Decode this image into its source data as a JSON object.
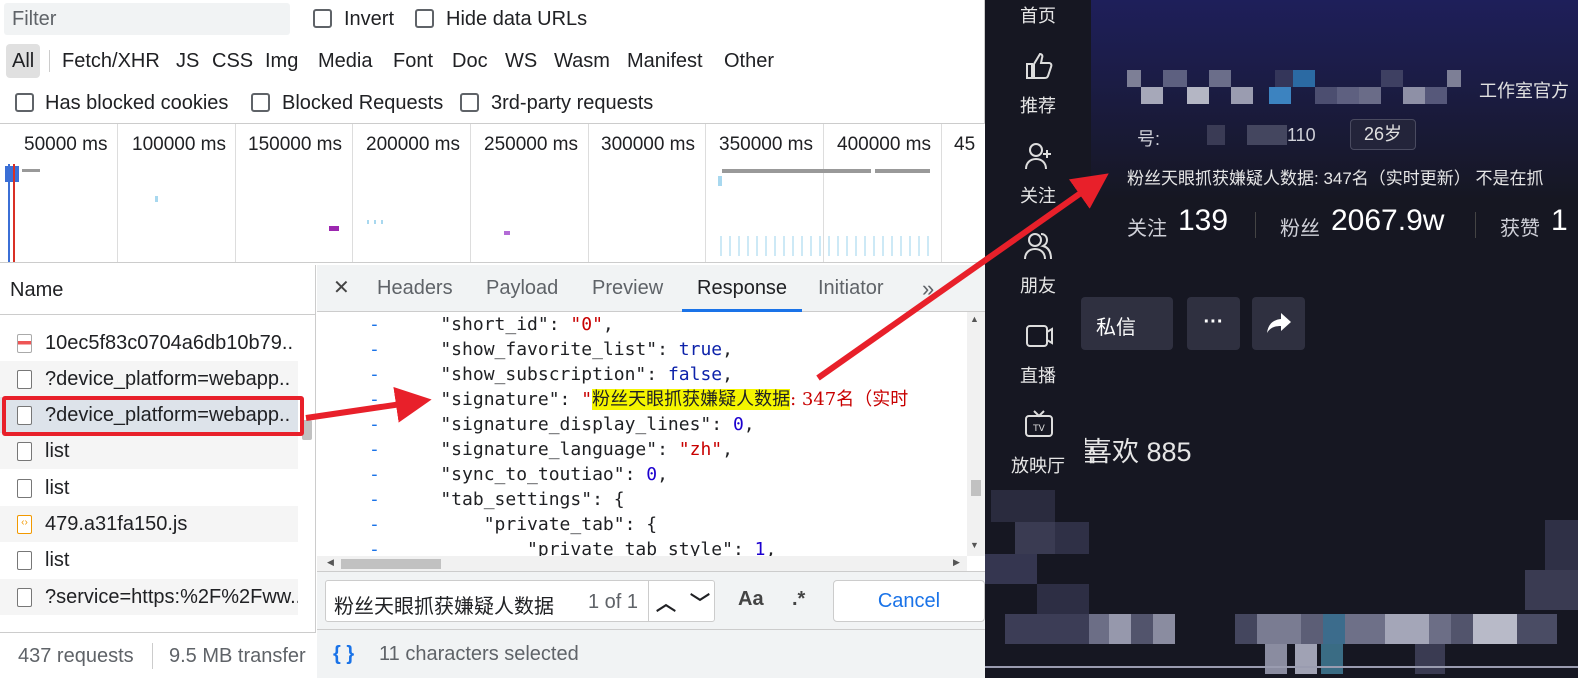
{
  "filter": {
    "placeholder": "Filter"
  },
  "options_row1": {
    "invert": "Invert",
    "hide_data_urls": "Hide data URLs"
  },
  "type_filters": [
    "All",
    "Fetch/XHR",
    "JS",
    "CSS",
    "Img",
    "Media",
    "Font",
    "Doc",
    "WS",
    "Wasm",
    "Manifest",
    "Other"
  ],
  "options_row2": {
    "blocked_cookies": "Has blocked cookies",
    "blocked_requests": "Blocked Requests",
    "third_party": "3rd-party requests"
  },
  "timeline_ticks": [
    "50000 ms",
    "100000 ms",
    "150000 ms",
    "200000 ms",
    "250000 ms",
    "300000 ms",
    "350000 ms",
    "400000 ms",
    "45"
  ],
  "requests": {
    "header": "Name",
    "rows": [
      "10ec5f83c0704a6db10b79..",
      "?device_platform=webapp..",
      "?device_platform=webapp..",
      "list",
      "list",
      "479.a31fa150.js",
      "list",
      "?service=https:%2F%2Fww.."
    ],
    "footer_count": "437 requests",
    "footer_transfer": "9.5 MB transfer"
  },
  "detail_tabs": {
    "close": "✕",
    "headers": "Headers",
    "payload": "Payload",
    "preview": "Preview",
    "response": "Response",
    "initiator": "Initiator",
    "more": "»"
  },
  "code_lines": [
    {
      "indent": "    ",
      "key": "\"short_id\"",
      "sep": ": ",
      "val": "\"0\"",
      "vtype": "s",
      "tail": ","
    },
    {
      "indent": "    ",
      "key": "\"show_favorite_list\"",
      "sep": ": ",
      "val": "true",
      "vtype": "lit",
      "tail": ","
    },
    {
      "indent": "    ",
      "key": "\"show_subscription\"",
      "sep": ": ",
      "val": "false",
      "vtype": "lit",
      "tail": ","
    },
    {
      "indent": "    ",
      "key": "\"signature\"",
      "sep": ": ",
      "val": "",
      "vtype": "sig",
      "tail": ""
    },
    {
      "indent": "    ",
      "key": "\"signature_display_lines\"",
      "sep": ": ",
      "val": "0",
      "vtype": "num",
      "tail": ","
    },
    {
      "indent": "    ",
      "key": "\"signature_language\"",
      "sep": ": ",
      "val": "\"zh\"",
      "vtype": "s",
      "tail": ","
    },
    {
      "indent": "    ",
      "key": "\"sync_to_toutiao\"",
      "sep": ": ",
      "val": "0",
      "vtype": "num",
      "tail": ","
    },
    {
      "indent": "    ",
      "key": "\"tab_settings\"",
      "sep": ": ",
      "val": "{",
      "vtype": "k",
      "tail": ""
    },
    {
      "indent": "        ",
      "key": "\"private_tab\"",
      "sep": ": ",
      "val": "{",
      "vtype": "k",
      "tail": ""
    },
    {
      "indent": "            ",
      "key": "\"private_tab_style\"",
      "sep": ": ",
      "val": "1",
      "vtype": "num",
      "tail": ","
    }
  ],
  "signature": {
    "quote": "\"",
    "highlight": "粉丝天眼抓获嫌疑人数据",
    "rest": ": 347名（实时"
  },
  "search": {
    "value": "粉丝天眼抓获嫌疑人数据",
    "count": "1 of 1",
    "match_case": "Aa",
    "regex": ".*",
    "cancel": "Cancel"
  },
  "status": {
    "braces": "{ }",
    "text": "11 characters selected"
  },
  "douyin": {
    "sidebar": [
      {
        "label": "首页",
        "icon": "home-icon"
      },
      {
        "label": "推荐",
        "icon": "thumbs-up-icon"
      },
      {
        "label": "关注",
        "icon": "add-user-icon"
      },
      {
        "label": "朋友",
        "icon": "friends-icon"
      },
      {
        "label": "直播",
        "icon": "live-icon"
      },
      {
        "label": "放映厅",
        "icon": "tv-icon"
      }
    ],
    "studio": "工作室官方",
    "id_label": "号:",
    "id_suffix": "110",
    "age": "26岁",
    "signature": "粉丝天眼抓获嫌疑人数据: 347名（实时更新） 不是在抓",
    "follow_label": "关注",
    "follow_count": "139",
    "fans_label": "粉丝",
    "fans_count": "2067.9w",
    "likes_label": "获赞",
    "likes_count": "1",
    "message": "私信",
    "more": "···",
    "likes_tab": "喜欢 885"
  },
  "colors": {
    "accent": "#1a73e8",
    "annotation": "#e8202a",
    "highlight": "#f5f500",
    "douyin_bg": "#161722"
  }
}
